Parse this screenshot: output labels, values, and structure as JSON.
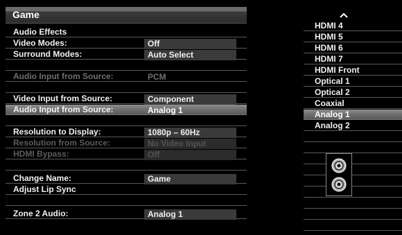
{
  "header": {
    "title": "Game"
  },
  "rows": [
    {
      "label": "Audio Effects",
      "value": ""
    },
    {
      "label": "Video Modes:",
      "value": "Off"
    },
    {
      "label": "Surround Modes:",
      "value": "Auto Select"
    },
    {
      "label": "",
      "value": ""
    },
    {
      "label": "Audio Input from Source:",
      "value": "PCM"
    },
    {
      "label": "",
      "value": ""
    },
    {
      "label": "Video Input from Source:",
      "value": "Component"
    },
    {
      "label": "Audio Input from Source:",
      "value": "Analog 1"
    },
    {
      "label": "",
      "value": ""
    },
    {
      "label": "Resolution to Display:",
      "value": "1080p – 60Hz"
    },
    {
      "label": "Resolution from Source:",
      "value": "No Video Input"
    },
    {
      "label": "HDMI Bypass:",
      "value": "Off"
    },
    {
      "label": "",
      "value": ""
    },
    {
      "label": "Change Name:",
      "value": "Game"
    },
    {
      "label": "Adjust Lip Sync",
      "value": ""
    },
    {
      "label": "",
      "value": ""
    },
    {
      "label": "Zone 2 Audio:",
      "value": "Analog 1"
    }
  ],
  "source_list": {
    "items": [
      "HDMI 4",
      "HDMI 5",
      "HDMI 6",
      "HDMI 7",
      "HDMI Front",
      "Optical 1",
      "Optical 2",
      "Coaxial",
      "Analog 1",
      "Analog 2"
    ],
    "selected": "Analog 1"
  },
  "icons": {
    "scroll_up": "chevron-up-icon",
    "connector": "rca-jack-icon"
  }
}
